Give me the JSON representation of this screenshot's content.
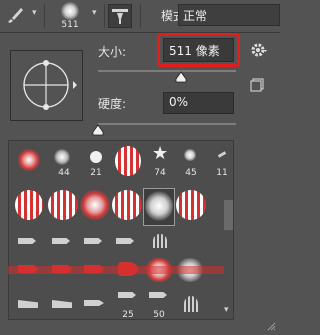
{
  "toolbar": {
    "brush_size_readout": "511",
    "mode_label": "模式:",
    "mode_value": "正常"
  },
  "brush_panel": {
    "size_label": "大小:",
    "size_value": "511 像素",
    "hardness_label": "硬度:",
    "hardness_value": "0%",
    "size_slider_level": 0.6,
    "hardness_slider_level": 0.0
  },
  "presets": {
    "row1_sizes": [
      "",
      "44",
      "21",
      "",
      "74",
      "45",
      "11"
    ],
    "row5_sizes": [
      "",
      "",
      "",
      "25",
      "50",
      ""
    ]
  },
  "colors": {
    "highlight": "#e41c1c",
    "panel_bg": "#535353",
    "field_bg": "#3a3a3a"
  }
}
